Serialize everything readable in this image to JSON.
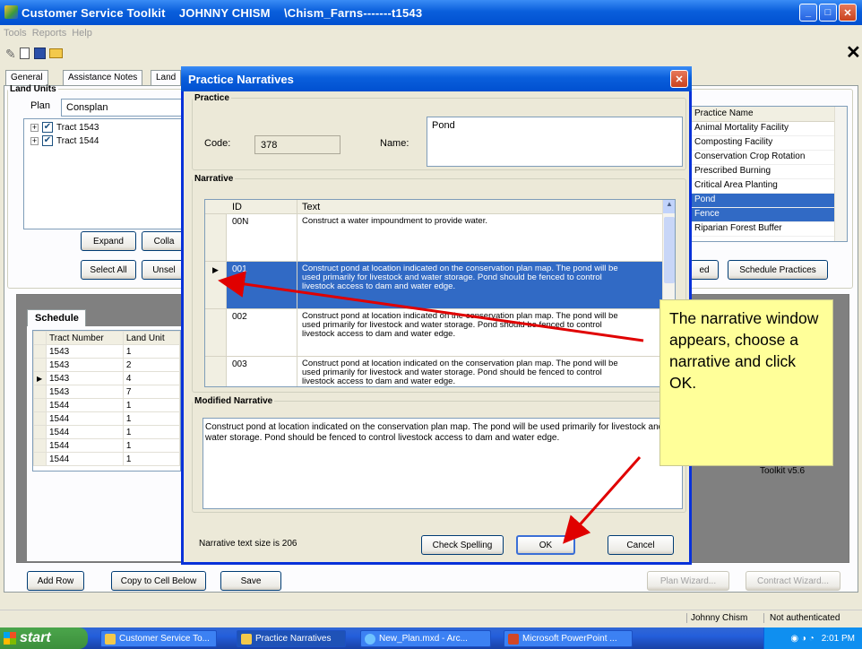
{
  "app": {
    "title": "Customer Service Toolkit    JOHNNY CHISM    \\Chism_Farns-------t1543"
  },
  "menu": [
    "Tools",
    "Reports",
    "Help"
  ],
  "tabs": [
    "General",
    "Assistance Notes",
    "Land"
  ],
  "land_units": {
    "legend": "Land Units",
    "plan_label": "Plan",
    "plan_value": "Consplan",
    "tracts": [
      "Tract 1543",
      "Tract 1544"
    ],
    "expand": "Expand",
    "collapse": "Colla",
    "select_all": "Select All",
    "unselect": "Unsel"
  },
  "practices": {
    "header": "Practice Name",
    "items": [
      "Animal Mortality Facility",
      "Composting Facility",
      "Conservation Crop Rotation",
      "Prescribed Burning",
      "Critical Area Planting",
      "Pond",
      "Fence",
      "Riparian Forest Buffer"
    ],
    "selected": [
      "Pond",
      "Fence"
    ],
    "ed_btn": "ed",
    "schedule_btn": "Schedule Practices"
  },
  "schedule": {
    "tab": "Schedule",
    "headers": [
      "Tract Number",
      "Land Unit"
    ],
    "rows": [
      [
        "1543",
        "1"
      ],
      [
        "1543",
        "2"
      ],
      [
        "1543",
        "4"
      ],
      [
        "1543",
        "7"
      ],
      [
        "1544",
        "1"
      ],
      [
        "1544",
        "1"
      ],
      [
        "1544",
        "1"
      ],
      [
        "1544",
        "1"
      ],
      [
        "1544",
        "1"
      ]
    ],
    "current_row": 2,
    "toolkit_text": "Toolkit v5.6"
  },
  "bottom_buttons": {
    "add_row": "Add Row",
    "copy": "Copy to Cell Below",
    "save": "Save",
    "plan_wizard": "Plan Wizard...",
    "contract_wizard": "Contract Wizard..."
  },
  "status": {
    "user": "Johnny Chism",
    "auth": "Not authenticated"
  },
  "dialog": {
    "title": "Practice Narratives",
    "practice_legend": "Practice",
    "code_label": "Code:",
    "code_value": "378",
    "name_label": "Name:",
    "name_value": "Pond",
    "narrative_legend": "Narrative",
    "col_id": "ID",
    "col_text": "Text",
    "rows": [
      {
        "id": "00N",
        "text": "Construct a water impoundment to provide water."
      },
      {
        "id": "001",
        "text": "Construct pond at location indicated on the conservation plan map.  The pond will be used primarily for livestock and water storage.  Pond should be fenced to control livestock access to dam and water edge."
      },
      {
        "id": "002",
        "text": "Construct pond at location indicated on the conservation plan map.  The pond will be used primarily for livestock and water storage.  Pond should be fenced to control livestock access to dam and water edge."
      },
      {
        "id": "003",
        "text": "Construct pond at location indicated on the conservation plan map.  The pond will be used primarily for livestock and water storage.  Pond should be fenced to control livestock access to dam and water edge."
      }
    ],
    "modified_legend": "Modified Narrative",
    "modified_text": "Construct pond at location indicated on the conservation plan map.  The pond will be used primarily for livestock and water storage.  Pond should be fenced to control livestock access to dam and water edge.",
    "size_text": "Narrative text size is 206",
    "check_spelling": "Check Spelling",
    "ok": "OK",
    "cancel": "Cancel"
  },
  "callout": "The narrative window appears, choose a narrative and click OK.",
  "taskbar": {
    "start": "start",
    "tasks": [
      "Customer Service To...",
      "Practice Narratives",
      "New_Plan.mxd - Arc...",
      "Microsoft PowerPoint ..."
    ],
    "clock": "2:01 PM"
  },
  "colors": {
    "selection": "#316ac5",
    "callout": "#ffff99",
    "arrow": "#e00000"
  }
}
